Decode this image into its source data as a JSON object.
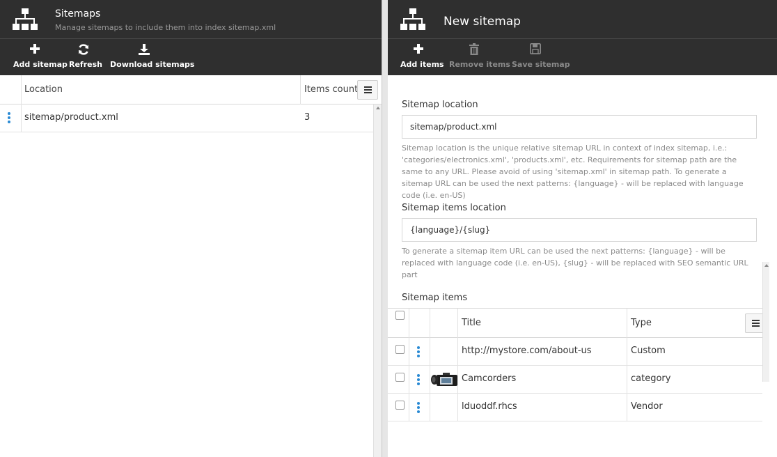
{
  "left_blade": {
    "title": "Sitemaps",
    "subtitle": "Manage sitemaps to include them into index sitemap.xml",
    "icon": "sitemap-icon",
    "toolbar": {
      "add_label": "Add sitemap",
      "refresh_label": "Refresh",
      "download_label": "Download sitemaps"
    },
    "grid": {
      "columns": [
        "Location",
        "Items count"
      ],
      "rows": [
        {
          "location": "sitemap/product.xml",
          "items_count": "3"
        }
      ]
    }
  },
  "right_blade": {
    "title": "New sitemap",
    "icon": "sitemap-icon",
    "toolbar": {
      "add_items_label": "Add items",
      "remove_items_label": "Remove items",
      "save_label": "Save sitemap"
    },
    "form": {
      "location_label": "Sitemap location",
      "location_value": "sitemap/product.xml",
      "location_help": "Sitemap location is the unique relative sitemap URL in context of index sitemap, i.e.: 'categories/electronics.xml', 'products.xml', etc. Requirements for sitemap path are the same to any URL. Please avoid of using 'sitemap.xml' in sitemap path. To generate a sitemap URL can be used the next patterns: {language} - will be replaced with language code (i.e. en-US)",
      "items_location_label": "Sitemap items location",
      "items_location_value": "{language}/{slug}",
      "items_location_help": "To generate a sitemap item URL can be used the next patterns: {language} - will be replaced with language code (i.e. en-US), {slug} - will be replaced with SEO semantic URL part"
    },
    "items": {
      "label": "Sitemap items",
      "columns": [
        "Title",
        "Type"
      ],
      "rows": [
        {
          "title": "http://mystore.com/about-us",
          "type": "Custom",
          "has_image": false
        },
        {
          "title": "Camcorders",
          "type": "category",
          "has_image": true
        },
        {
          "title": "lduoddf.rhcs",
          "type": "Vendor",
          "has_image": false
        }
      ]
    }
  },
  "colors": {
    "header_bg": "#2f2f2f",
    "accent": "#2a8ad4",
    "disabled_text": "#8a8a8a"
  }
}
